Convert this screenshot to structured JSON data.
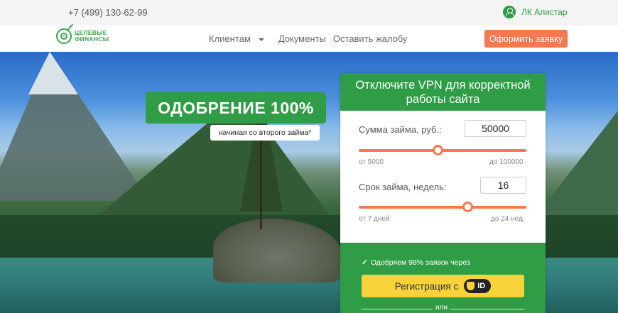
{
  "topbar": {
    "phone": "+7 (499) 130-62-99",
    "account_link": "ЛК Алистар"
  },
  "nav": {
    "logo_line1": "ЦЕЛЕВЫЕ",
    "logo_line2": "ФИНАНСЫ",
    "items": [
      {
        "label": "Клиентам",
        "has_dropdown": true
      },
      {
        "label": "Документы"
      },
      {
        "label": "Оставить жалобу"
      }
    ],
    "cta": "Оформить заявку"
  },
  "hero": {
    "headline": "ОДОБРЕНИЕ 100%",
    "subheadline": "начиная со второго займа*"
  },
  "form": {
    "title": "Отключите VPN для корректной работы сайта",
    "amount": {
      "label": "Сумма займа, руб.:",
      "value": "50000",
      "min_label": "от 5000",
      "max_label": "до 100000",
      "min": 5000,
      "max": 100000,
      "current": 50000
    },
    "term": {
      "label": "Срок займа, недель:",
      "value": "16",
      "min_label": "от 7 дней",
      "max_label": "до 24 нед.",
      "min": 1,
      "max": 24,
      "current": 16
    },
    "approve_text": "Одобряем 98% заявок через",
    "register_label": "Регистрация с",
    "id_label": "ID",
    "or_text": "или"
  },
  "colors": {
    "brand_green": "#2e9d46",
    "accent_orange": "#f6784e",
    "button_yellow": "#f8d23b"
  }
}
